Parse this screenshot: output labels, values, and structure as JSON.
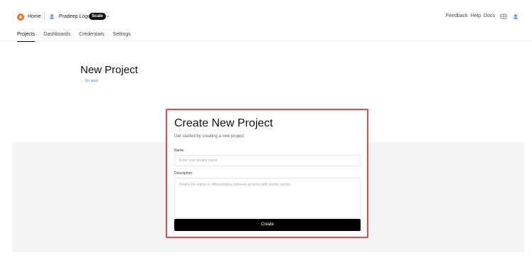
{
  "header": {
    "home_label": "Home",
    "user_name": "Pradeep Logu",
    "plan_badge": "Scale",
    "icons": {
      "home": "home-logo-icon",
      "user": "user-avatar-icon",
      "dropdown": "chevron-down-icon",
      "grid": "grid-icon",
      "avatar": "avatar-icon"
    },
    "right_links": [
      "Feedback",
      "Help",
      "Docs"
    ]
  },
  "tabs": [
    {
      "label": "Projects",
      "active": true
    },
    {
      "label": "Dashboards",
      "active": false
    },
    {
      "label": "Credentials",
      "active": false
    },
    {
      "label": "Settings",
      "active": false
    }
  ],
  "page": {
    "title": "New Project",
    "back_link": "← Go back"
  },
  "form": {
    "title": "Create New Project",
    "subtitle": "Get started by creating a new project",
    "name_label": "Name",
    "name_placeholder": "Enter your project name",
    "name_value": "",
    "description_label": "Description",
    "description_placeholder": "Helpful for teams or differentiating between projects with similar names",
    "description_value": "",
    "submit_label": "Create"
  },
  "colors": {
    "accent": "#f97316",
    "highlight_border": "#e5484d",
    "button_bg": "#000000",
    "link": "#3b82f6"
  }
}
